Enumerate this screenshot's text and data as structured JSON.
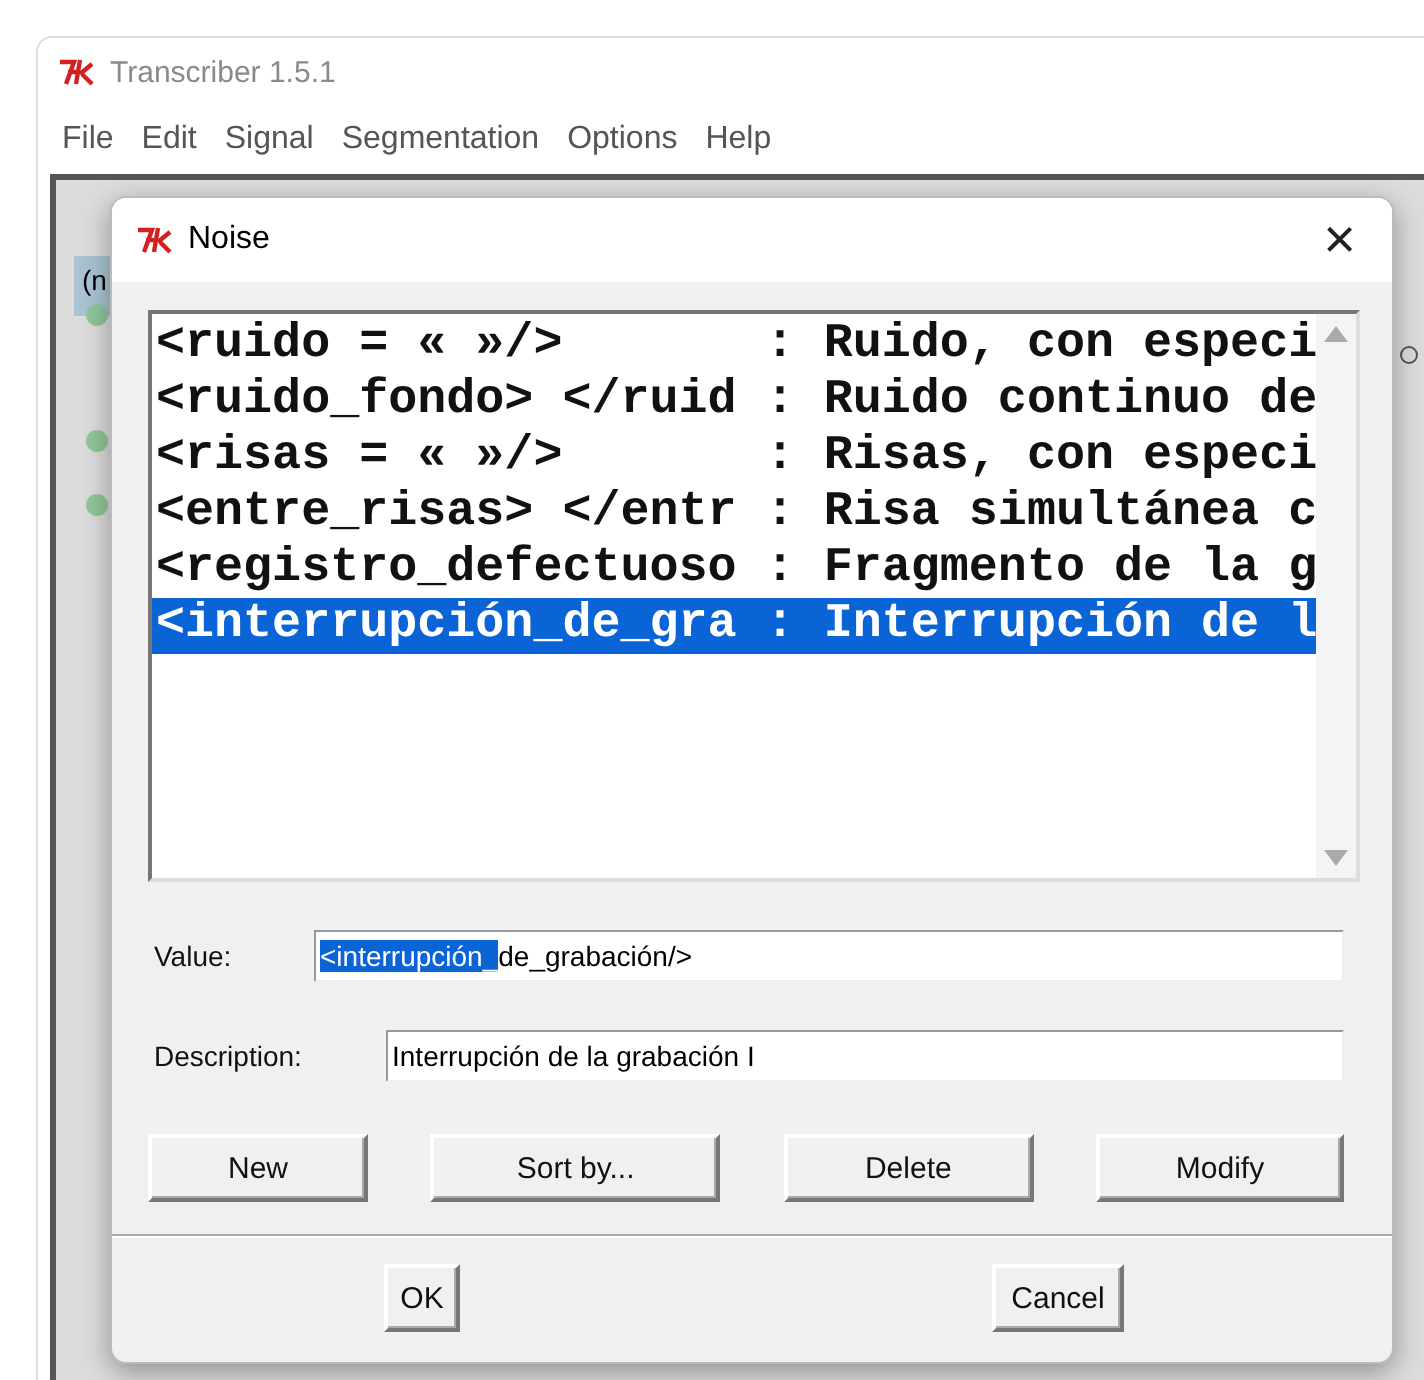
{
  "window": {
    "title": "Transcriber 1.5.1"
  },
  "menu": [
    "File",
    "Edit",
    "Signal",
    "Segmentation",
    "Options",
    "Help"
  ],
  "background": {
    "tab": "(n"
  },
  "dialog": {
    "title": "Noise",
    "close": "×",
    "list": [
      {
        "text": "<ruido = « »/>       : Ruido, con especi",
        "selected": false
      },
      {
        "text": "<ruido_fondo> </ruid : Ruido continuo de",
        "selected": false
      },
      {
        "text": "<risas = « »/>       : Risas, con especi",
        "selected": false
      },
      {
        "text": "<entre_risas> </entr : Risa simultánea c",
        "selected": false
      },
      {
        "text": "<registro_defectuoso : Fragmento de la g",
        "selected": false
      },
      {
        "text": "<interrupción_de_gra : Interrupción de l",
        "selected": true
      }
    ],
    "value": {
      "label": "Value:",
      "selected_text": "<interrupción_",
      "rest_text": "de_grabación/>"
    },
    "description": {
      "label": "Description:",
      "value": "Interrupción de la grabación I"
    },
    "actions": [
      "New",
      "Sort by...",
      "Delete",
      "Modify"
    ],
    "buttons": [
      "OK",
      "Cancel"
    ]
  }
}
